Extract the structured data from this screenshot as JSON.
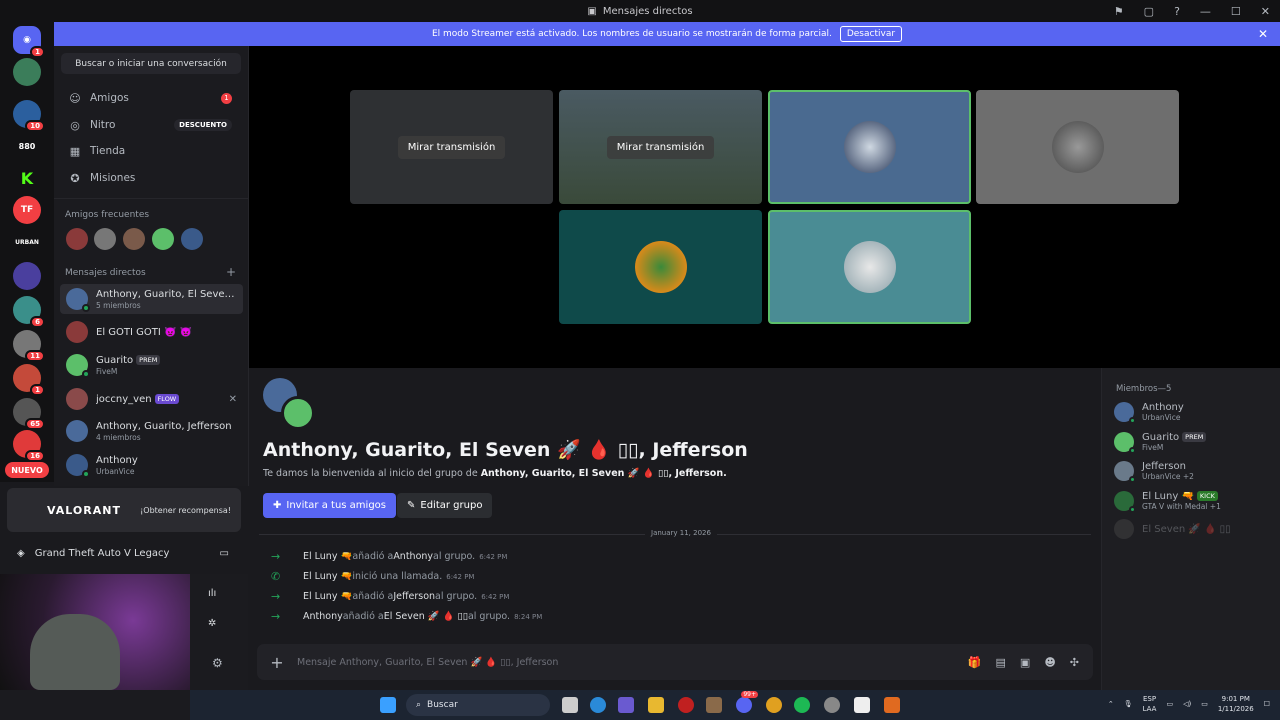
{
  "window": {
    "title": "Mensajes directos"
  },
  "rail": {
    "badges": [
      "1",
      "10",
      "6",
      "11",
      "1",
      "65",
      "16"
    ],
    "server_labels": [
      "880",
      "URBAN"
    ],
    "new_label": "NUEVO"
  },
  "banner": {
    "text": "El modo Streamer está activado. Los nombres de usuario se mostrarán de forma parcial.",
    "button": "Desactivar"
  },
  "sidebar": {
    "search_label": "Buscar o iniciar una conversación",
    "nav": [
      {
        "label": "Amigos",
        "badge": "1"
      },
      {
        "label": "Nitro",
        "badge": "DESCUENTO"
      },
      {
        "label": "Tienda"
      },
      {
        "label": "Misiones"
      }
    ],
    "frequent_header": "Amigos frecuentes",
    "dm_header": "Mensajes directos",
    "dms": [
      {
        "name": "Anthony, Guarito, El Seven...",
        "sub": "5 miembros"
      },
      {
        "name": "El GOTI GOTI 👿 👿",
        "sub": ""
      },
      {
        "name": "Guarito",
        "tag": "PREM",
        "sub": "FiveM"
      },
      {
        "name": "joccny_ven",
        "tag": "FLOW",
        "sub": ""
      },
      {
        "name": "Anthony, Guarito, Jefferson",
        "sub": "4 miembros"
      },
      {
        "name": "Anthony",
        "sub": "UrbanVice"
      }
    ]
  },
  "promo": {
    "logo": "VALORANT",
    "cta": "¡Obtener recompensa!"
  },
  "activity": {
    "game": "Grand Theft Auto V Legacy"
  },
  "stage": {
    "watch_label": "Mirar transmisión"
  },
  "chat": {
    "group_name": "Anthony, Guarito, El Seven 🚀 🩸 ▯▯, Jefferson",
    "welcome_prefix": "Te damos la bienvenida al inicio del grupo de ",
    "welcome_names": "Anthony, Guarito, El Seven 🚀 🩸 ▯▯, Jefferson.",
    "invite_btn": "Invitar a tus amigos",
    "edit_btn": "Editar grupo",
    "date": "January 11, 2026",
    "events": [
      {
        "actor": "El Luny 🔫",
        "action": " añadió a ",
        "target": "Anthony",
        "suffix": " al grupo.",
        "time": "6:42 PM"
      },
      {
        "actor": "El Luny 🔫",
        "action": " inició una llamada.",
        "target": "",
        "suffix": "",
        "time": "6:42 PM"
      },
      {
        "actor": "El Luny 🔫",
        "action": " añadió a ",
        "target": "Jefferson",
        "suffix": " al grupo.",
        "time": "6:42 PM"
      },
      {
        "actor": "Anthony",
        "action": " añadió a ",
        "target": "El Seven 🚀 🩸 ▯▯",
        "suffix": " al grupo.",
        "time": "8:24 PM"
      }
    ],
    "message_placeholder": "Mensaje Anthony, Guarito, El Seven 🚀 🩸 ▯▯, Jefferson"
  },
  "members": {
    "header": "Miembros—5",
    "list": [
      {
        "name": "Anthony",
        "sub": "UrbanVice"
      },
      {
        "name": "Guarito",
        "tag": "PREM",
        "sub": "FiveM"
      },
      {
        "name": "Jefferson",
        "sub": "UrbanVice +2"
      },
      {
        "name": "El Luny 🔫",
        "tag": "KICK",
        "sub": "GTA V with Medal +1"
      },
      {
        "name": "El Seven 🚀 🩸 ▯▯",
        "sub": ""
      }
    ]
  },
  "taskbar": {
    "search": "Buscar",
    "lang": "ESP",
    "lang2": "LAA",
    "time": "9:01 PM",
    "date": "1/11/2026",
    "discord_badge": "99+"
  },
  "colors": {
    "accent": "#5865f2",
    "online": "#23a55a",
    "badge": "#f23f43"
  }
}
